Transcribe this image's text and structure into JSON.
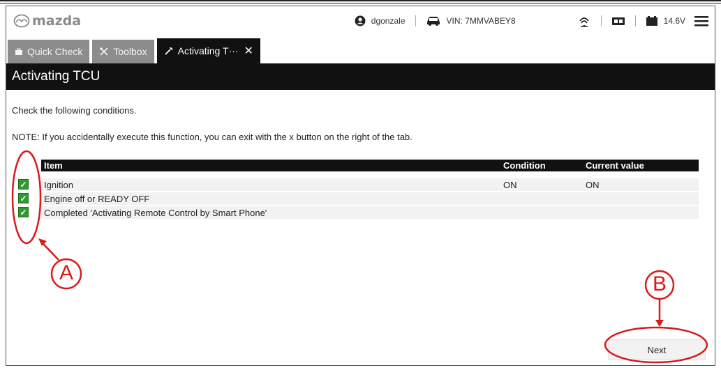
{
  "header": {
    "brand": "mazda",
    "user": "dgonzale",
    "vin": "VIN: 7MMVABEY8",
    "voltage": "14.6V"
  },
  "tabs": [
    {
      "label": "Quick Check",
      "icon": "briefcase-icon"
    },
    {
      "label": "Toolbox",
      "icon": "tools-icon"
    },
    {
      "label": "Activating T···",
      "icon": "wrench-icon",
      "active": true
    }
  ],
  "page": {
    "title": "Activating TCU",
    "instruction": "Check the following conditions.",
    "note": "NOTE: If you accidentally execute this function, you can exit with the x button on the right of the tab."
  },
  "table": {
    "columns": [
      "Item",
      "Condition",
      "Current value"
    ],
    "rows": [
      {
        "item": "Ignition",
        "condition": "ON",
        "current": "ON",
        "checked": true
      },
      {
        "item": "Engine off or READY OFF",
        "condition": "",
        "current": "",
        "checked": true
      },
      {
        "item": "Completed 'Activating Remote Control by Smart Phone'",
        "condition": "",
        "current": "",
        "checked": true
      }
    ]
  },
  "buttons": {
    "next": "Next"
  },
  "callouts": {
    "a": "A",
    "b": "B"
  },
  "colors": {
    "accent_red": "#d81a1a",
    "check_green": "#2f9a2f",
    "tab_gray": "#8c8c8c",
    "titlebar": "#111111"
  }
}
